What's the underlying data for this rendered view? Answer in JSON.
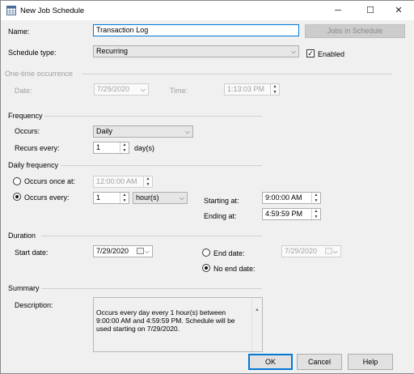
{
  "window": {
    "title": "New Job Schedule",
    "minimize_glyph": "─",
    "maximize_glyph": "☐",
    "close_glyph": "✕"
  },
  "name_row": {
    "label": "Name:",
    "value": "Transaction Log",
    "jobs_button": "Jobs in Schedule"
  },
  "schedule_type": {
    "label": "Schedule type:",
    "value": "Recurring",
    "enabled_label": "Enabled",
    "enabled_checked": true
  },
  "one_time": {
    "section": "One-time occurrence",
    "date_label": "Date:",
    "date_value": "7/29/2020",
    "time_label": "Time:",
    "time_value": "1:13:03 PM"
  },
  "frequency": {
    "section": "Frequency",
    "occurs_label": "Occurs:",
    "occurs_value": "Daily",
    "recurs_label": "Recurs every:",
    "recurs_value": "1",
    "recurs_unit": "day(s)"
  },
  "daily_frequency": {
    "section": "Daily frequency",
    "once_label": "Occurs once at:",
    "once_value": "12:00:00 AM",
    "every_label": "Occurs every:",
    "every_value": "1",
    "every_unit": "hour(s)",
    "starting_label": "Starting at:",
    "starting_value": "9:00:00 AM",
    "ending_label": "Ending at:",
    "ending_value": "4:59:59 PM",
    "mode": "every"
  },
  "duration": {
    "section": "Duration",
    "start_label": "Start date:",
    "start_value": "7/29/2020",
    "end_label": "End date:",
    "end_value": "7/29/2020",
    "no_end_label": "No end date:",
    "mode": "no_end"
  },
  "summary": {
    "section": "Summary",
    "description_label": "Description:",
    "description_text": "Occurs every day every 1 hour(s) between 9:00:00 AM and 4:59:59 PM. Schedule will be used starting on 7/29/2020."
  },
  "buttons": {
    "ok": "OK",
    "cancel": "Cancel",
    "help": "Help"
  },
  "icons": {
    "app": "calendar-grid-icon",
    "check": "✓",
    "dropdown": "⌵",
    "spin_up": "▲",
    "spin_down": "▼"
  }
}
